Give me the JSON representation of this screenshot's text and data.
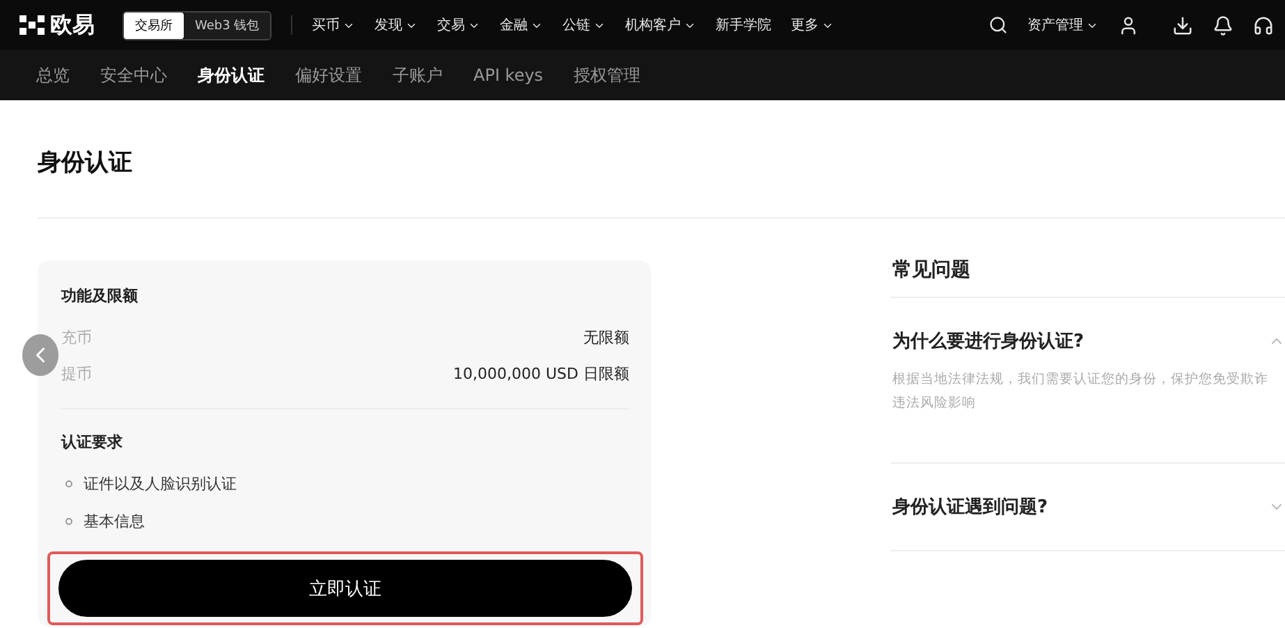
{
  "logo": {
    "text": "欧易"
  },
  "switcher": [
    {
      "label": "交易所",
      "selected": true
    },
    {
      "label": "Web3 钱包",
      "selected": false
    }
  ],
  "nav": [
    {
      "label": "买币",
      "dropdown": true
    },
    {
      "label": "发现",
      "dropdown": true
    },
    {
      "label": "交易",
      "dropdown": true
    },
    {
      "label": "金融",
      "dropdown": true
    },
    {
      "label": "公链",
      "dropdown": true
    },
    {
      "label": "机构客户",
      "dropdown": true
    },
    {
      "label": "新手学院",
      "dropdown": false
    },
    {
      "label": "更多",
      "dropdown": true
    }
  ],
  "asset_menu": {
    "label": "资产管理"
  },
  "subnav": [
    {
      "label": "总览",
      "selected": false
    },
    {
      "label": "安全中心",
      "selected": false
    },
    {
      "label": "身份认证",
      "selected": true
    },
    {
      "label": "偏好设置",
      "selected": false
    },
    {
      "label": "子账户",
      "selected": false
    },
    {
      "label": "API keys",
      "selected": false
    },
    {
      "label": "授权管理",
      "selected": false
    }
  ],
  "page_title": "身份认证",
  "card": {
    "limits_title": "功能及限额",
    "limits": [
      {
        "label": "充币",
        "value": "无限额"
      },
      {
        "label": "提币",
        "value": "10,000,000 USD 日限额"
      }
    ],
    "requirements_title": "认证要求",
    "requirements": [
      "证件以及人脸识别认证",
      "基本信息"
    ],
    "button": {
      "label": "立即认证",
      "highlighted": true
    }
  },
  "faq": {
    "title": "常见问题",
    "items": [
      {
        "question": "为什么要进行身份认证?",
        "expanded": true,
        "answer_lines": [
          "根据当地法律法规，我们需要认证您的身份，保护您免受欺诈",
          "违法风险影响"
        ]
      },
      {
        "question": "身份认证遇到问题?",
        "expanded": false
      }
    ]
  }
}
